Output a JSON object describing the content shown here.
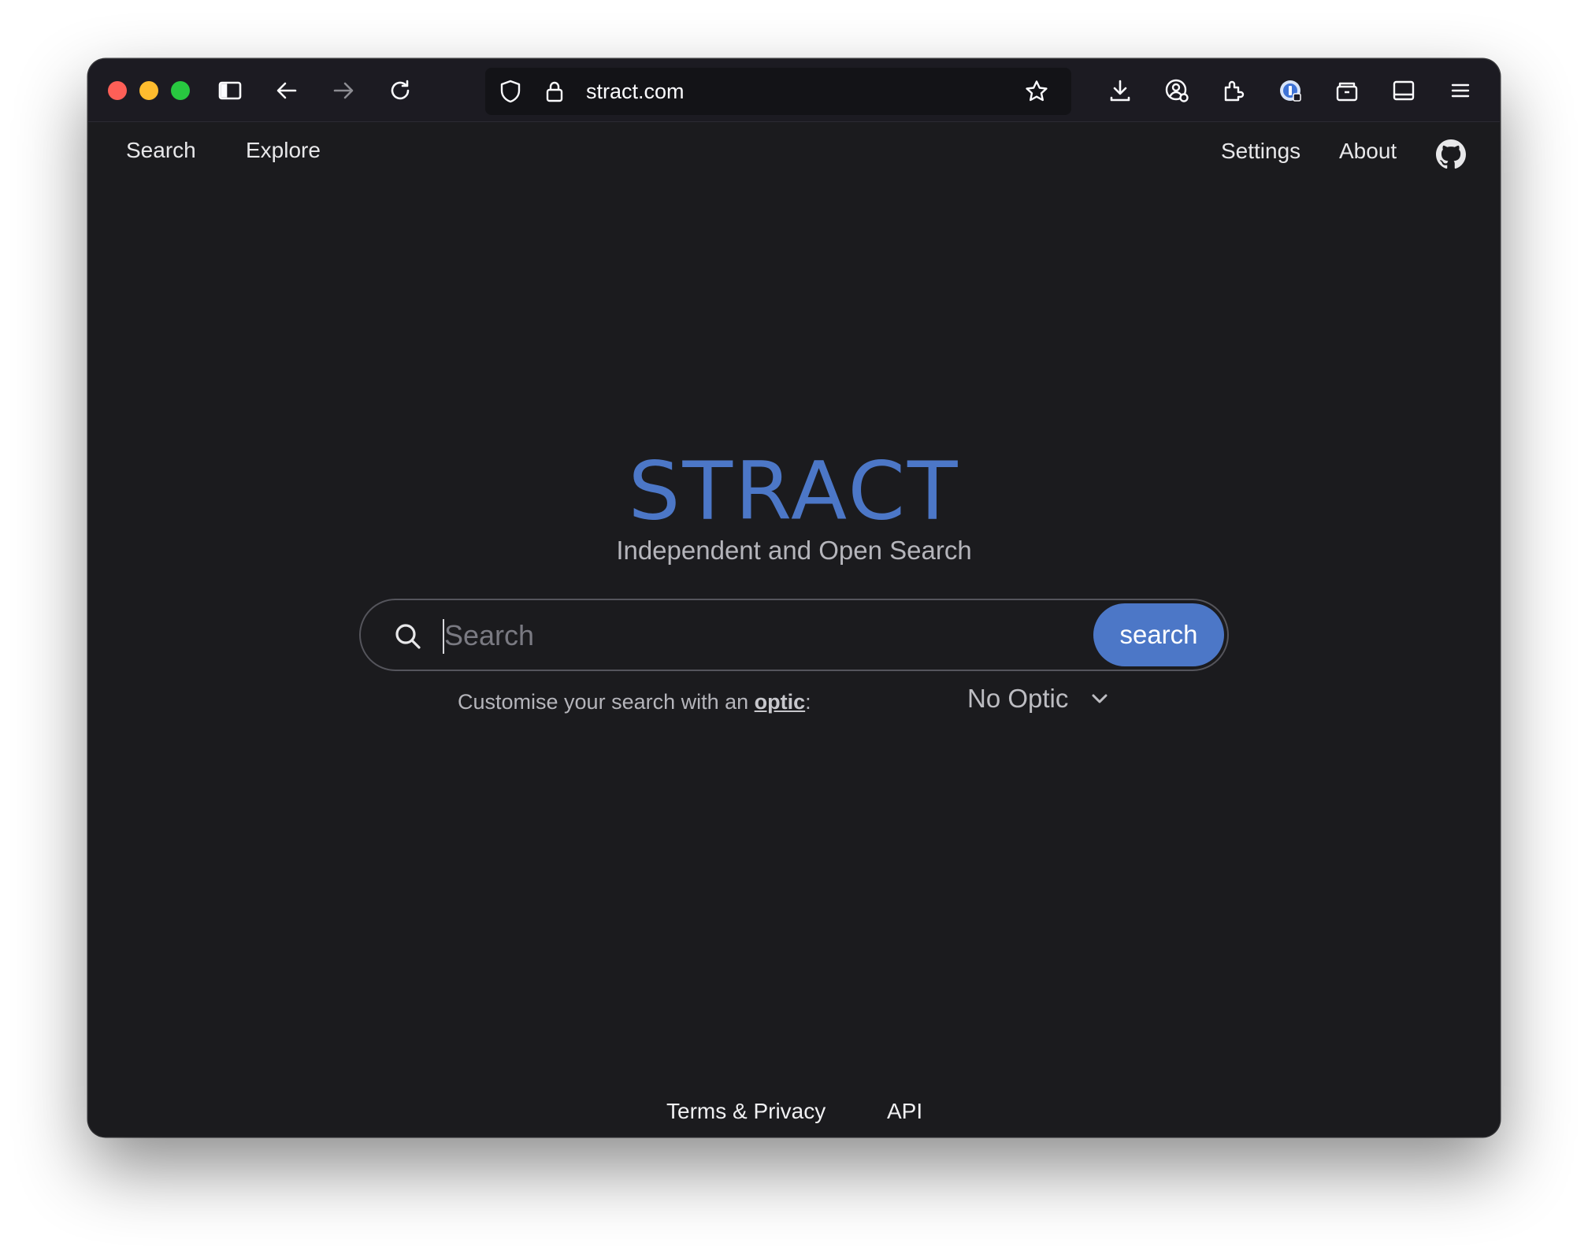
{
  "browser": {
    "url": "stract.com"
  },
  "nav": {
    "search": "Search",
    "explore": "Explore",
    "settings": "Settings",
    "about": "About"
  },
  "hero": {
    "brand": "STRACT",
    "tagline": "Independent and Open Search"
  },
  "search": {
    "placeholder": "Search",
    "button_label": "search"
  },
  "optic": {
    "prefix": "Customise your search with an ",
    "link": "optic",
    "suffix": ":",
    "selected": "No Optic"
  },
  "footer": {
    "terms": "Terms & Privacy",
    "api": "API"
  },
  "colors": {
    "accent": "#4c77c7",
    "page_bg": "#1b1b1e",
    "toolbar_bg": "#1c1b22"
  }
}
